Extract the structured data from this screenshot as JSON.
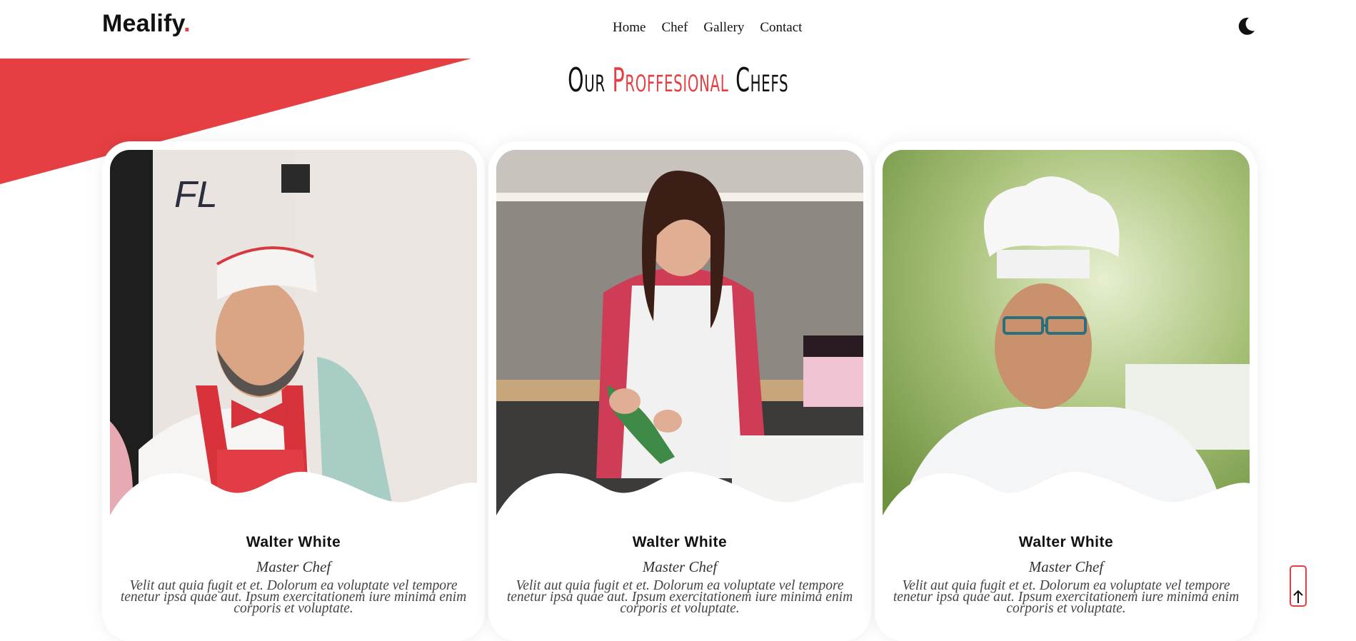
{
  "brand": {
    "name": "Mealify",
    "dot": "."
  },
  "nav": {
    "items": [
      "Home",
      "Chef",
      "Gallery",
      "Contact"
    ]
  },
  "theme_toggle": {
    "icon": "moon-icon"
  },
  "section": {
    "title_pre": "Our",
    "title_accent": "Proffesional",
    "title_post": "Chefs"
  },
  "chefs": [
    {
      "name": "Walter White",
      "role": "Master Chef",
      "desc": "Velit aut quia fugit et et. Dolorum ea voluptate vel tempore tenetur ipsa quae aut. Ipsum exercitationem iure minima enim corporis et voluptate."
    },
    {
      "name": "Walter White",
      "role": "Master Chef",
      "desc": "Velit aut quia fugit et et. Dolorum ea voluptate vel tempore tenetur ipsa quae aut. Ipsum exercitationem iure minima enim corporis et voluptate."
    },
    {
      "name": "Walter White",
      "role": "Master Chef",
      "desc": "Velit aut quia fugit et et. Dolorum ea voluptate vel tempore tenetur ipsa quae aut. Ipsum exercitationem iure minima enim corporis et voluptate."
    }
  ],
  "scroll_top": {
    "icon": "arrow-up-icon"
  },
  "colors": {
    "accent": "#e53f43",
    "text": "#111111",
    "background": "#ffffff"
  }
}
